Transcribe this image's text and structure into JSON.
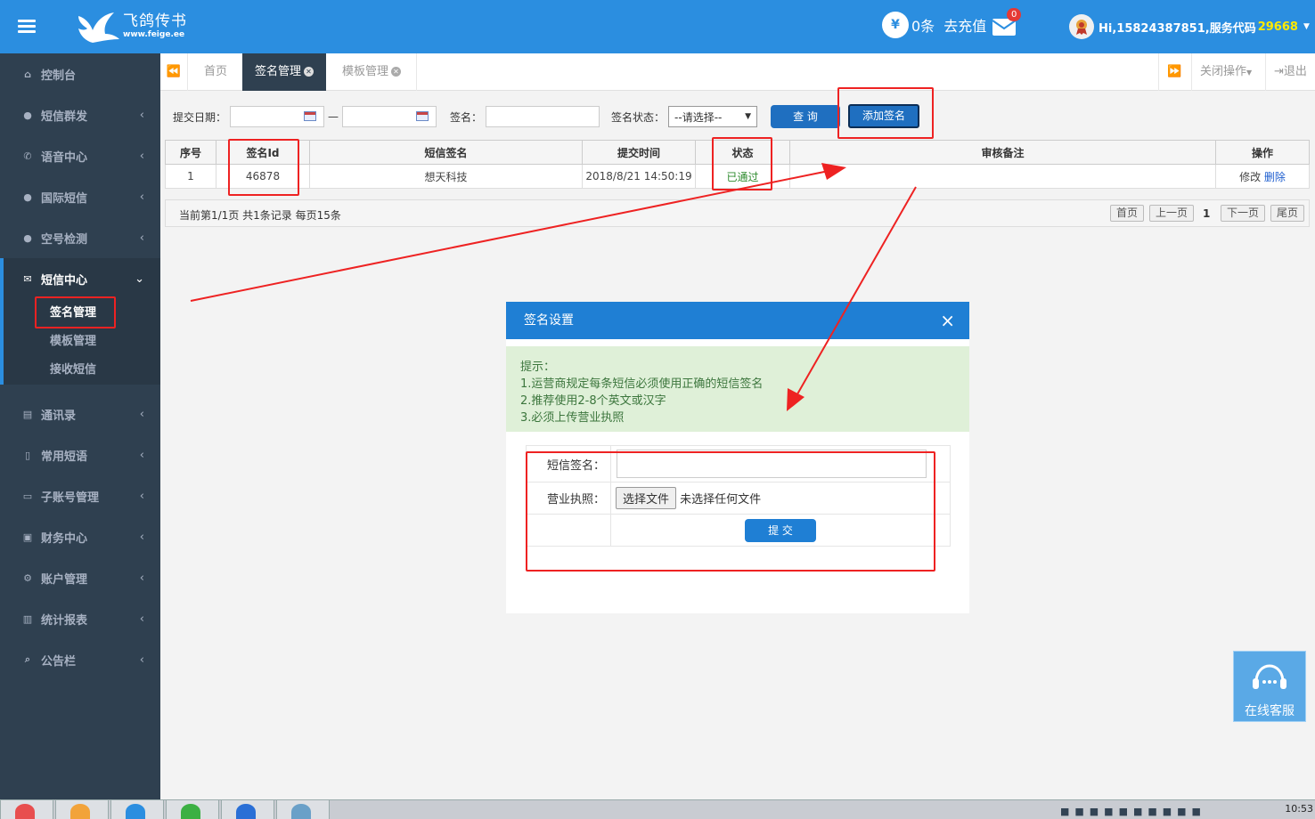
{
  "header": {
    "logo_text": "飞鸽传书",
    "logo_domain": "www.feige.ee",
    "balance": "0条",
    "recharge": "去充值",
    "mail_count": "0",
    "user": "Hi,15824387851,服务代码",
    "service_code": "29668",
    "coin_symbol": "¥"
  },
  "sidebar": {
    "items": [
      {
        "label": "控制台",
        "icon": "home-icon"
      },
      {
        "label": "短信群发",
        "icon": "group-icon"
      },
      {
        "label": "语音中心",
        "icon": "phone-icon"
      },
      {
        "label": "国际短信",
        "icon": "globe-icon"
      },
      {
        "label": "空号检测",
        "icon": "detect-icon"
      },
      {
        "label": "短信中心",
        "icon": "envelope-icon"
      },
      {
        "label": "通讯录",
        "icon": "book-icon"
      },
      {
        "label": "常用短语",
        "icon": "file-icon"
      },
      {
        "label": "子账号管理",
        "icon": "desktop-icon"
      },
      {
        "label": "财务中心",
        "icon": "money-icon"
      },
      {
        "label": "账户管理",
        "icon": "gear-icon"
      },
      {
        "label": "统计报表",
        "icon": "chart-icon"
      },
      {
        "label": "公告栏",
        "icon": "search-icon"
      }
    ],
    "sub_items": [
      "签名管理",
      "模板管理",
      "接收短信"
    ]
  },
  "tabs": {
    "home": "首页",
    "sign": "签名管理",
    "template": "模板管理",
    "close_ops": "关闭操作",
    "logout": "退出"
  },
  "filter": {
    "date_label": "提交日期：",
    "dash": "—",
    "sign_label": "签名：",
    "status_label": "签名状态：",
    "status_value": "--请选择--",
    "query": "查 询",
    "add": "添加签名"
  },
  "table": {
    "headers": [
      "序号",
      "签名Id",
      "短信签名",
      "提交时间",
      "状态",
      "审核备注",
      "操作"
    ],
    "rows": [
      {
        "no": "1",
        "id": "46878",
        "sign": "想天科技",
        "time": "2018/8/21 14:50:19",
        "status": "已通过",
        "remark": "",
        "edit": "修改",
        "del": "删除"
      }
    ]
  },
  "pager": {
    "info": "当前第1/1页 共1条记录 每页15条",
    "first": "首页",
    "prev": "上一页",
    "current": "1",
    "next": "下一页",
    "last": "尾页"
  },
  "modal": {
    "title": "签名设置",
    "close": "×",
    "tip_title": "提示：",
    "tips": [
      "1.运营商规定每条短信必须使用正确的短信签名",
      "2.推荐使用2-8个英文或汉字",
      "3.必须上传营业执照"
    ],
    "sign_label": "短信签名：",
    "license_label": "营业执照：",
    "file_btn": "选择文件",
    "no_file": "未选择任何文件",
    "submit": "提 交"
  },
  "service": {
    "label": "在线客服"
  },
  "taskbar": {
    "time": "10:53"
  },
  "colors": {
    "primary": "#2b8ee0",
    "sidebar": "#2f4050",
    "annotation": "#ee2222",
    "success": "#3c763d"
  }
}
